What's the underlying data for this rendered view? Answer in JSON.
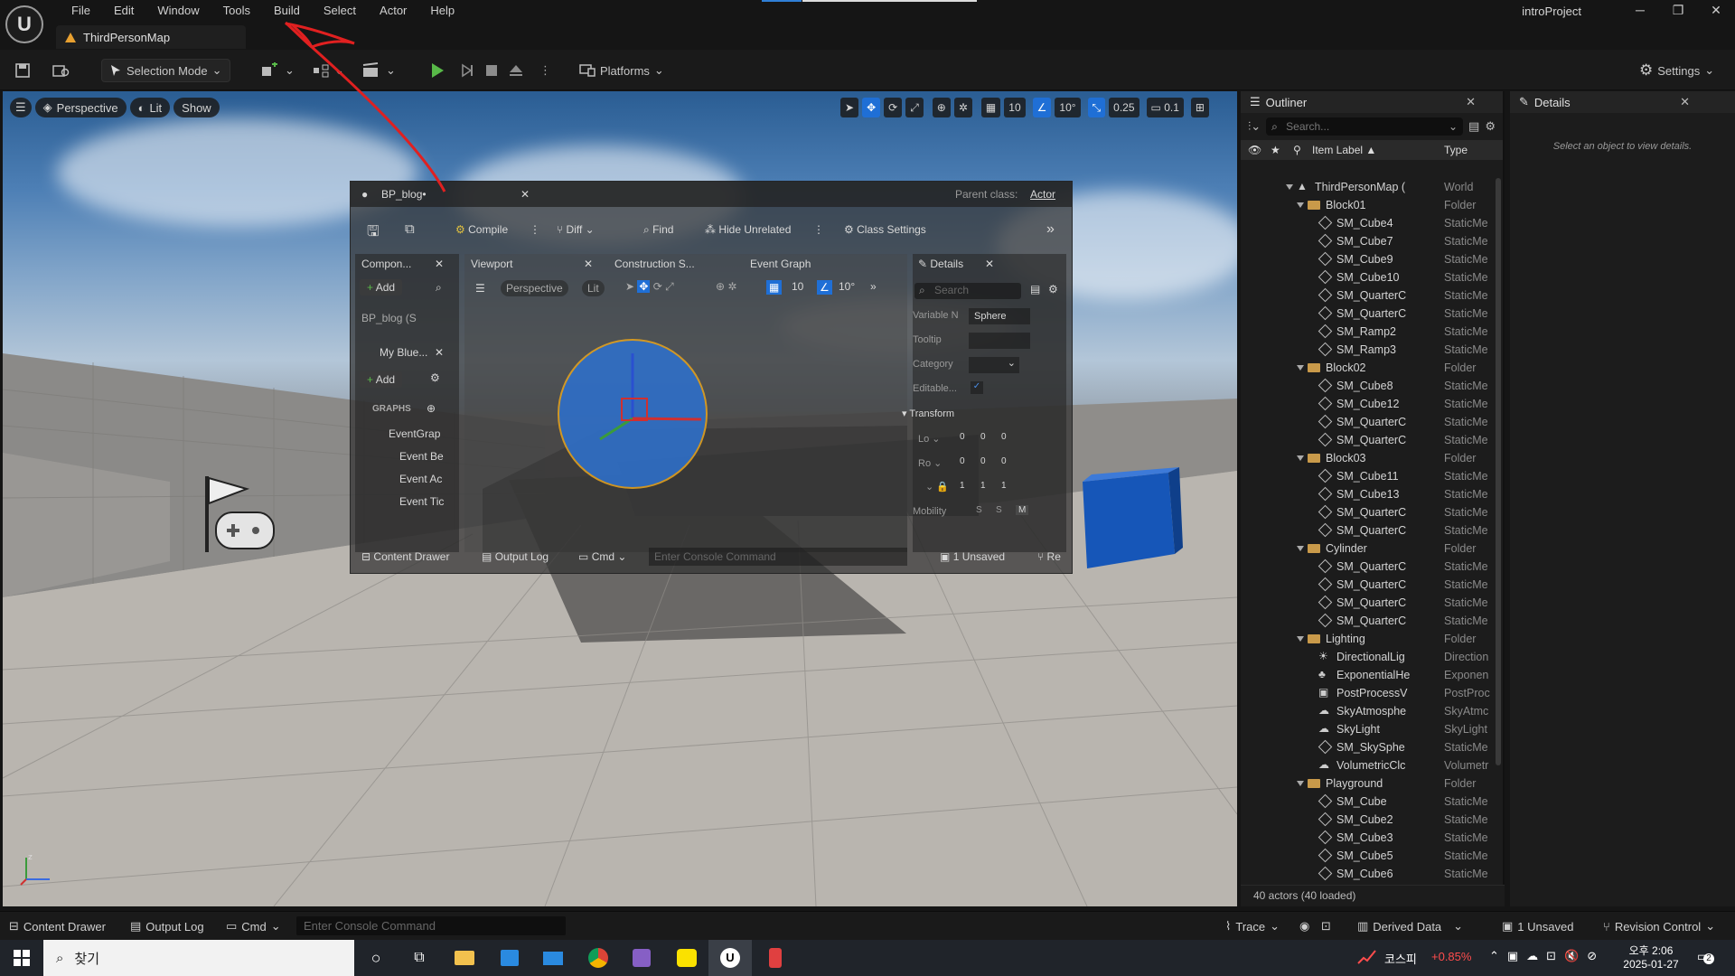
{
  "menu": [
    "File",
    "Edit",
    "Window",
    "Tools",
    "Build",
    "Select",
    "Actor",
    "Help"
  ],
  "map_tab": "ThirdPersonMap",
  "project_name": "introProject",
  "window_buttons": {
    "minimize": "─",
    "restore": "❐",
    "close": "✕"
  },
  "toolbar": {
    "selection_mode": "Selection Mode",
    "platforms": "Platforms",
    "settings": "Settings"
  },
  "viewport": {
    "perspective": "Perspective",
    "lit": "Lit",
    "show": "Show",
    "grid_snap": "10",
    "rotation_snap": "10°",
    "scale_snap": "0.25",
    "camera_speed": "0.1"
  },
  "blueprint": {
    "tab_title": "BP_blog•",
    "parent_class_label": "Parent class:",
    "parent_class_value": "Actor",
    "compile": "Compile",
    "diff": "Diff",
    "find": "Find",
    "hide_unrelated": "Hide Unrelated",
    "class_settings": "Class Settings",
    "components_tab": "Compon...",
    "add": "Add",
    "component_root": "BP_blog (S",
    "my_blueprint_tab": "My Blue...",
    "graphs_header": "GRAPHS",
    "event_graph_item": "EventGrap",
    "events": [
      "Event Be",
      "Event Ac",
      "Event Tic"
    ],
    "viewport_tab": "Viewport",
    "construction_tab": "Construction S...",
    "event_graph_tab": "Event Graph",
    "vp_perspective": "Perspective",
    "vp_lit": "Lit",
    "vp_grid": "10",
    "vp_rot": "10°",
    "details_tab": "Details",
    "details_search": "Search",
    "variable_name_label": "Variable N",
    "variable_name_value": "Sphere",
    "tooltip_label": "Tooltip",
    "category_label": "Category",
    "editable_label": "Editable...",
    "transform_header": "Transform",
    "loc_label": "Lo",
    "rot_label": "Ro",
    "loc_values": [
      "0",
      "0",
      "0"
    ],
    "rot_values": [
      "0",
      "0",
      "0"
    ],
    "scale_values": [
      "1",
      "1",
      "1"
    ],
    "mobility_label": "Mobility",
    "mobility_options": [
      "S",
      "S",
      "M"
    ],
    "content_drawer": "Content Drawer",
    "output_log": "Output Log",
    "cmd": "Cmd",
    "console_placeholder": "Enter Console Command",
    "unsaved": "1 Unsaved",
    "revision": "Re"
  },
  "outliner": {
    "title": "Outliner",
    "search_placeholder": "Search...",
    "col_label": "Item Label ▲",
    "col_type": "Type",
    "rows": [
      {
        "label": "ThirdPersonMap (",
        "type": "World",
        "kind": "world",
        "depth": 0
      },
      {
        "label": "Block01",
        "type": "Folder",
        "kind": "folder",
        "depth": 1
      },
      {
        "label": "SM_Cube4",
        "type": "StaticMe",
        "kind": "mesh",
        "depth": 2
      },
      {
        "label": "SM_Cube7",
        "type": "StaticMe",
        "kind": "mesh",
        "depth": 2
      },
      {
        "label": "SM_Cube9",
        "type": "StaticMe",
        "kind": "mesh",
        "depth": 2
      },
      {
        "label": "SM_Cube10",
        "type": "StaticMe",
        "kind": "mesh",
        "depth": 2
      },
      {
        "label": "SM_QuarterC",
        "type": "StaticMe",
        "kind": "mesh",
        "depth": 2
      },
      {
        "label": "SM_QuarterC",
        "type": "StaticMe",
        "kind": "mesh",
        "depth": 2
      },
      {
        "label": "SM_Ramp2",
        "type": "StaticMe",
        "kind": "mesh",
        "depth": 2
      },
      {
        "label": "SM_Ramp3",
        "type": "StaticMe",
        "kind": "mesh",
        "depth": 2
      },
      {
        "label": "Block02",
        "type": "Folder",
        "kind": "folder",
        "depth": 1
      },
      {
        "label": "SM_Cube8",
        "type": "StaticMe",
        "kind": "mesh",
        "depth": 2
      },
      {
        "label": "SM_Cube12",
        "type": "StaticMe",
        "kind": "mesh",
        "depth": 2
      },
      {
        "label": "SM_QuarterC",
        "type": "StaticMe",
        "kind": "mesh",
        "depth": 2
      },
      {
        "label": "SM_QuarterC",
        "type": "StaticMe",
        "kind": "mesh",
        "depth": 2
      },
      {
        "label": "Block03",
        "type": "Folder",
        "kind": "folder",
        "depth": 1
      },
      {
        "label": "SM_Cube11",
        "type": "StaticMe",
        "kind": "mesh",
        "depth": 2
      },
      {
        "label": "SM_Cube13",
        "type": "StaticMe",
        "kind": "mesh",
        "depth": 2
      },
      {
        "label": "SM_QuarterC",
        "type": "StaticMe",
        "kind": "mesh",
        "depth": 2
      },
      {
        "label": "SM_QuarterC",
        "type": "StaticMe",
        "kind": "mesh",
        "depth": 2
      },
      {
        "label": "Cylinder",
        "type": "Folder",
        "kind": "folder",
        "depth": 1
      },
      {
        "label": "SM_QuarterC",
        "type": "StaticMe",
        "kind": "mesh",
        "depth": 2
      },
      {
        "label": "SM_QuarterC",
        "type": "StaticMe",
        "kind": "mesh",
        "depth": 2
      },
      {
        "label": "SM_QuarterC",
        "type": "StaticMe",
        "kind": "mesh",
        "depth": 2
      },
      {
        "label": "SM_QuarterC",
        "type": "StaticMe",
        "kind": "mesh",
        "depth": 2
      },
      {
        "label": "Lighting",
        "type": "Folder",
        "kind": "folder",
        "depth": 1
      },
      {
        "label": "DirectionalLig",
        "type": "Direction",
        "kind": "light",
        "depth": 2
      },
      {
        "label": "ExponentialHe",
        "type": "Exponen",
        "kind": "fog",
        "depth": 2
      },
      {
        "label": "PostProcessV",
        "type": "PostProc",
        "kind": "pp",
        "depth": 2
      },
      {
        "label": "SkyAtmosphe",
        "type": "SkyAtmc",
        "kind": "sky",
        "depth": 2
      },
      {
        "label": "SkyLight",
        "type": "SkyLight",
        "kind": "sky",
        "depth": 2
      },
      {
        "label": "SM_SkySphe",
        "type": "StaticMe",
        "kind": "mesh",
        "depth": 2
      },
      {
        "label": "VolumetricClc",
        "type": "Volumetr",
        "kind": "sky",
        "depth": 2
      },
      {
        "label": "Playground",
        "type": "Folder",
        "kind": "folder",
        "depth": 1
      },
      {
        "label": "SM_Cube",
        "type": "StaticMe",
        "kind": "mesh",
        "depth": 2
      },
      {
        "label": "SM_Cube2",
        "type": "StaticMe",
        "kind": "mesh",
        "depth": 2
      },
      {
        "label": "SM_Cube3",
        "type": "StaticMe",
        "kind": "mesh",
        "depth": 2
      },
      {
        "label": "SM_Cube5",
        "type": "StaticMe",
        "kind": "mesh",
        "depth": 2
      },
      {
        "label": "SM_Cube6",
        "type": "StaticMe",
        "kind": "mesh",
        "depth": 2
      }
    ],
    "footer": "40 actors (40 loaded)"
  },
  "details": {
    "title": "Details",
    "empty_message": "Select an object to view details."
  },
  "statusbar": {
    "content_drawer": "Content Drawer",
    "output_log": "Output Log",
    "cmd": "Cmd",
    "console_placeholder": "Enter Console Command",
    "trace": "Trace",
    "derived_data": "Derived Data",
    "unsaved": "1 Unsaved",
    "revision_control": "Revision Control"
  },
  "taskbar": {
    "search": "찾기",
    "stock_name": "코스피",
    "stock_change": "+0.85%",
    "time": "오후 2:06",
    "date": "2025-01-27",
    "notification_count": "2"
  },
  "colors": {
    "accent": "#1f6fd6",
    "play_green": "#58b948",
    "folder": "#c99a4a",
    "annotation_red": "#e02020",
    "stock_red": "#ff4d4d"
  }
}
